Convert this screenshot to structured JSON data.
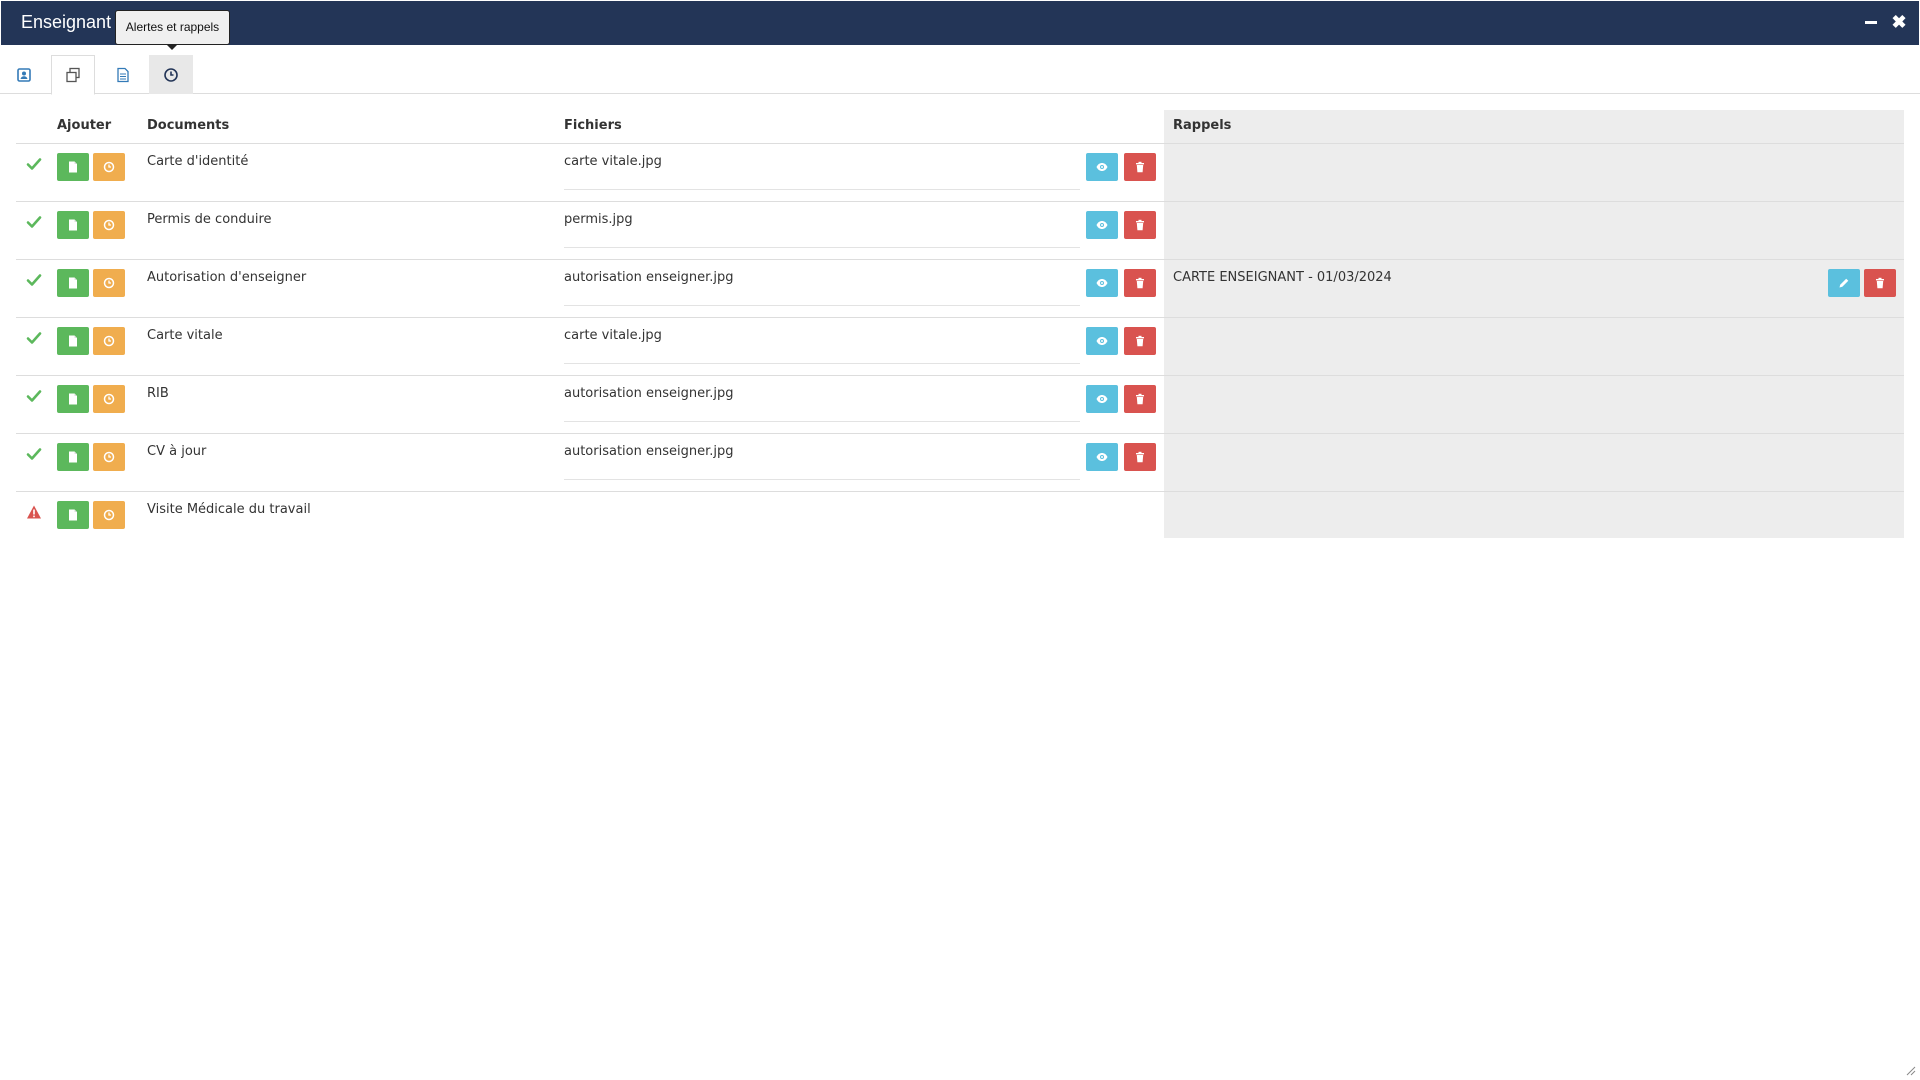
{
  "window": {
    "title": "Enseignant    DS Lourds",
    "minimize_label": "minimize",
    "close_label": "✖"
  },
  "tabs": [
    {
      "icon": "contact-card-icon",
      "label": "Fiche"
    },
    {
      "icon": "documents-copy-icon",
      "label": "Documents",
      "active": true
    },
    {
      "icon": "file-text-icon",
      "label": "Fichier"
    },
    {
      "icon": "clock-icon",
      "label": "Alertes et rappels"
    }
  ],
  "tooltip": "Alertes et rappels",
  "table": {
    "headers": {
      "add": "Ajouter",
      "documents": "Documents",
      "files": "Fichiers",
      "reminders": "Rappels"
    },
    "rows": [
      {
        "status": "ok",
        "document": "Carte d'identité",
        "file": "carte vitale.jpg",
        "reminder": ""
      },
      {
        "status": "ok",
        "document": "Permis de conduire",
        "file": "permis.jpg",
        "reminder": ""
      },
      {
        "status": "ok",
        "document": "Autorisation d'enseigner",
        "file": "autorisation enseigner.jpg",
        "reminder": "CARTE ENSEIGNANT - 01/03/2024"
      },
      {
        "status": "ok",
        "document": "Carte vitale",
        "file": "carte vitale.jpg",
        "reminder": ""
      },
      {
        "status": "ok",
        "document": "RIB",
        "file": "autorisation enseigner.jpg",
        "reminder": ""
      },
      {
        "status": "ok",
        "document": "CV à jour",
        "file": "autorisation enseigner.jpg",
        "reminder": ""
      },
      {
        "status": "warning",
        "document": "Visite Médicale du travail",
        "file": "",
        "reminder": ""
      }
    ]
  },
  "colors": {
    "titlebar": "#233557",
    "green": "#5cb85c",
    "orange": "#f0ad4e",
    "blue": "#5bc0de",
    "red": "#d9534f",
    "check": "#5cb85c",
    "warning": "#d9534f",
    "rappels_bg": "#ededed"
  }
}
